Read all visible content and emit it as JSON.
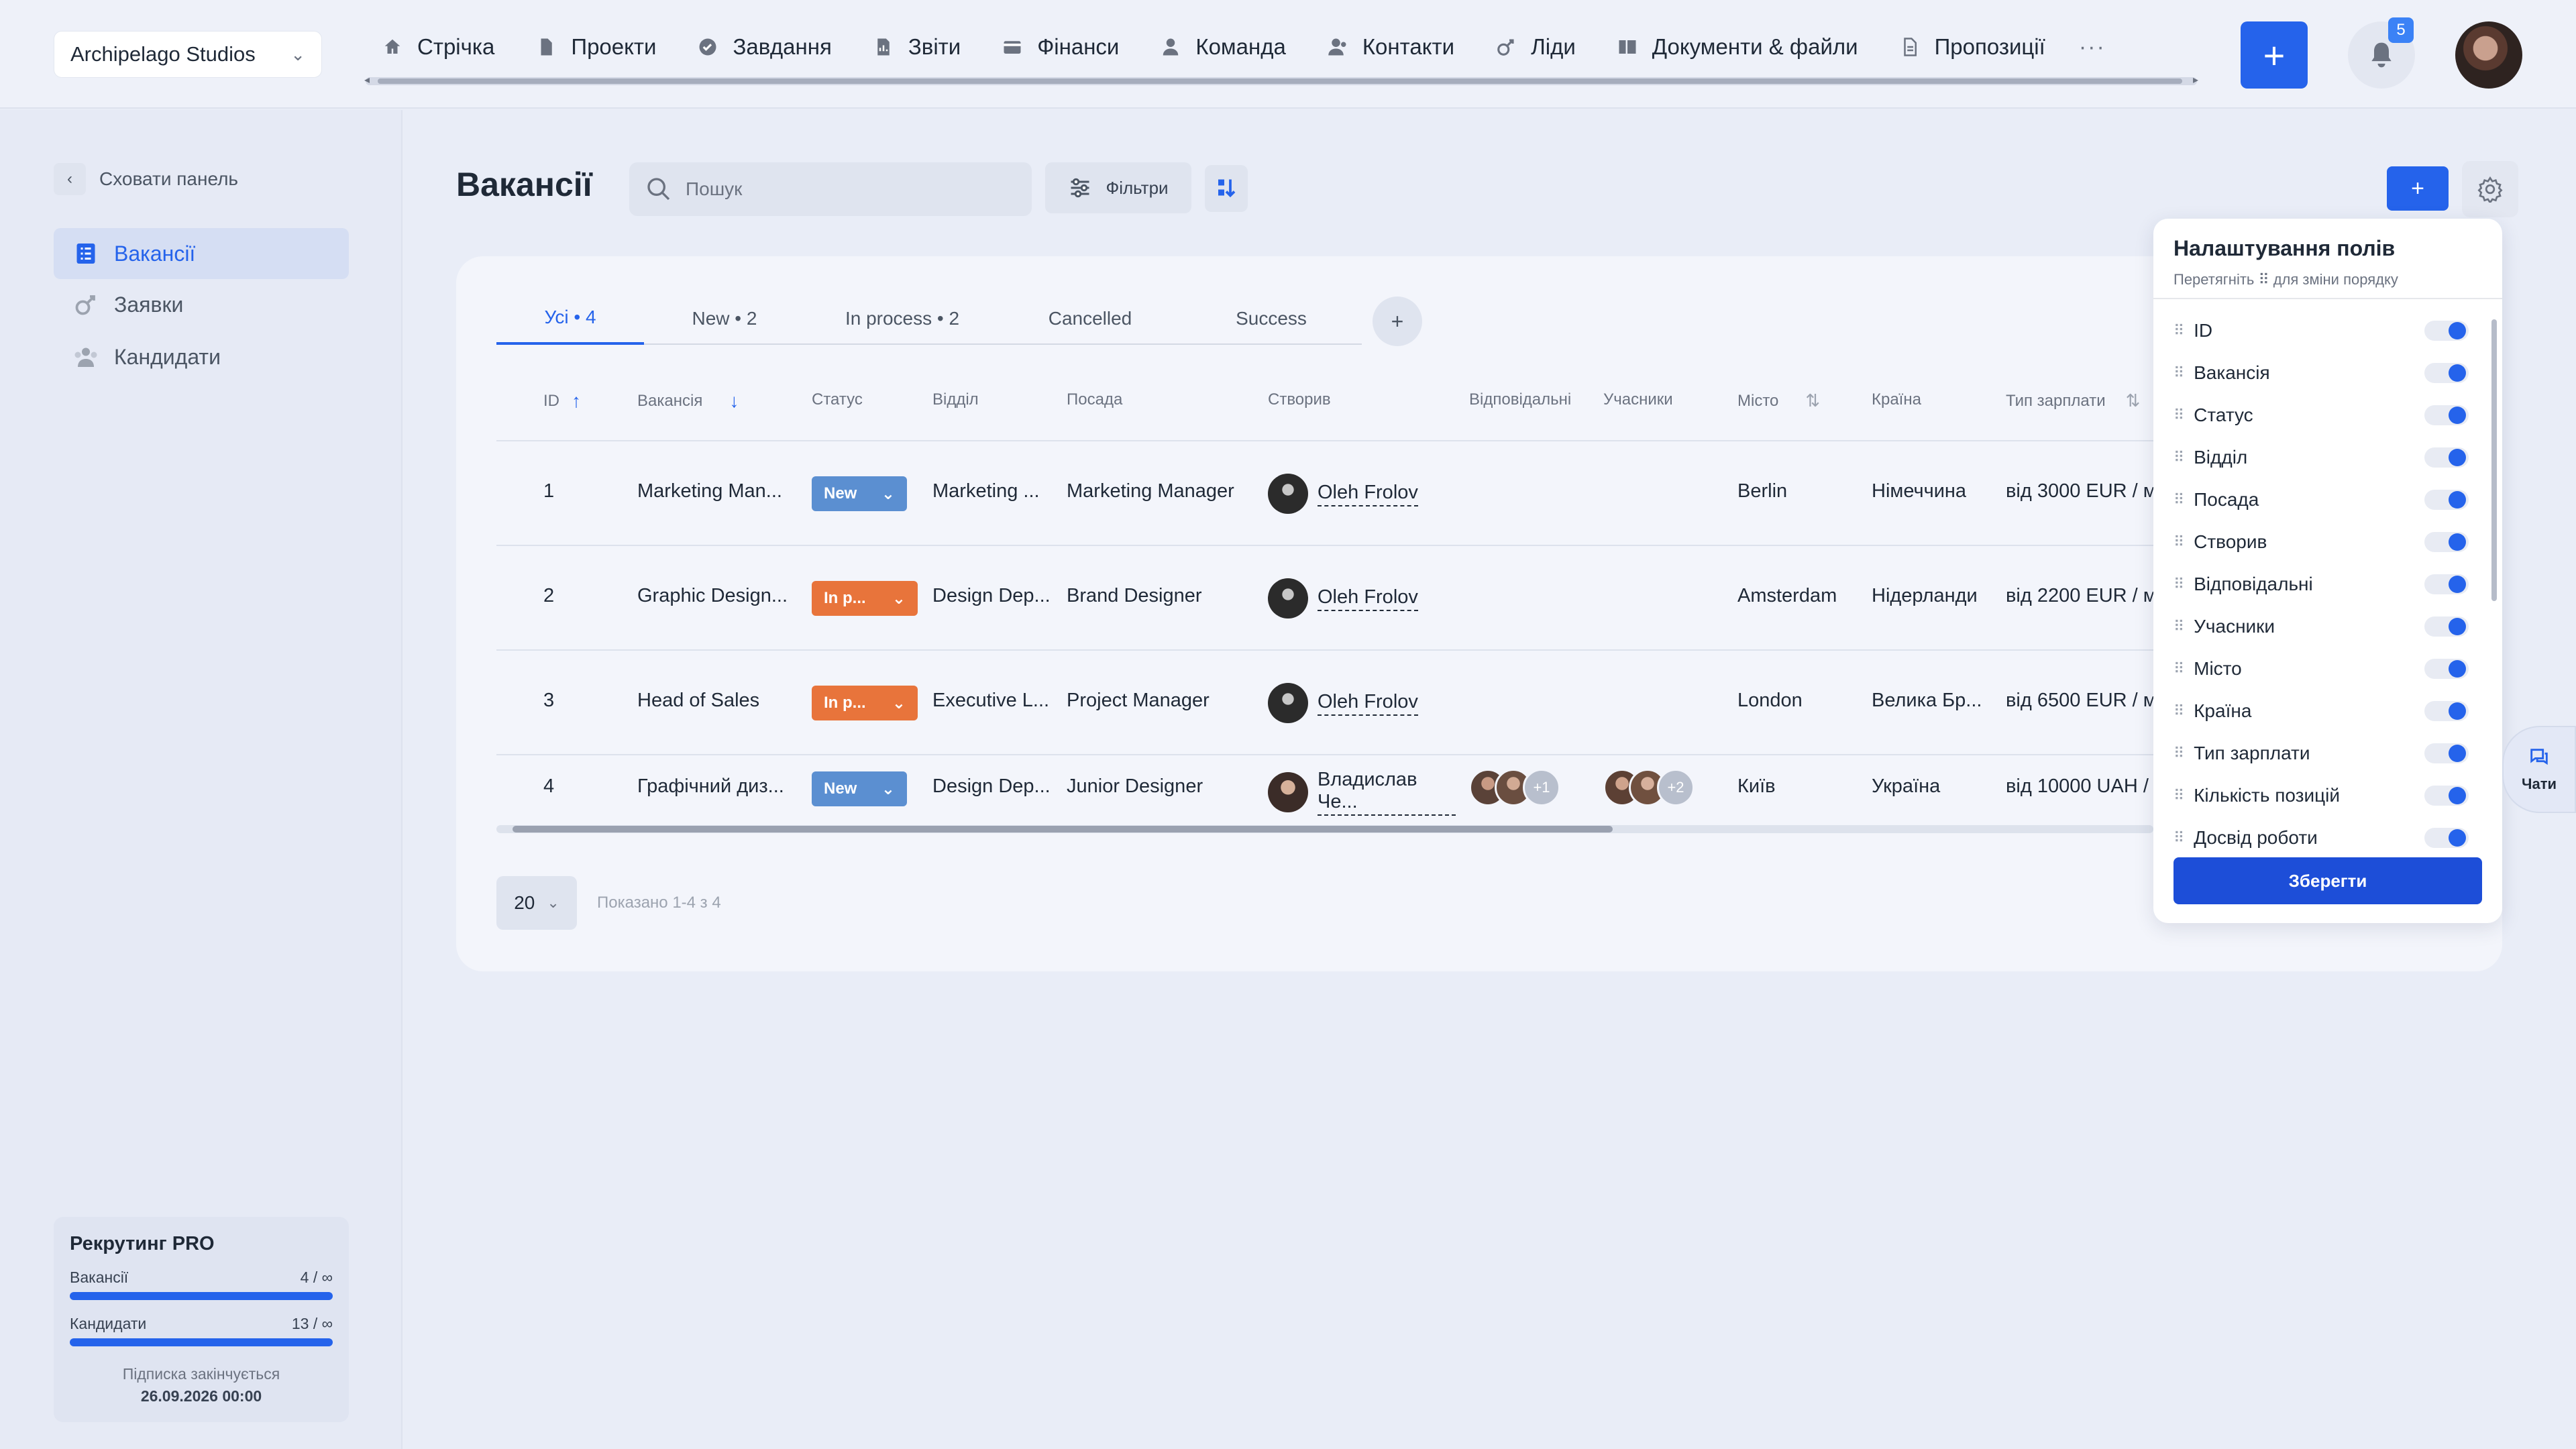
{
  "workspace": {
    "name": "Archipelago Studios"
  },
  "nav": {
    "items": [
      "Стрічка",
      "Проекти",
      "Завдання",
      "Звіти",
      "Фінанси",
      "Команда",
      "Контакти",
      "Ліди",
      "Документи & файли",
      "Пропозиції"
    ],
    "more": "···",
    "add": "+",
    "notifications": "5"
  },
  "sidebar": {
    "hide": "Сховати панель",
    "items": [
      "Вакансії",
      "Заявки",
      "Кандидати"
    ]
  },
  "plan": {
    "title": "Рекрутинг PRO",
    "rows": [
      {
        "label": "Вакансії",
        "value": "4 / ∞"
      },
      {
        "label": "Кандидати",
        "value": "13 / ∞"
      }
    ],
    "note": "Підписка закінчується",
    "date": "26.09.2026 00:00"
  },
  "page": {
    "title": "Вакансії",
    "search_placeholder": "Пошук",
    "filters": "Фільтри",
    "add": "+"
  },
  "tabs": [
    {
      "label": "Усі • 4",
      "active": true
    },
    {
      "label": "New • 2"
    },
    {
      "label": "In process • 2"
    },
    {
      "label": "Cancelled"
    },
    {
      "label": "Success"
    }
  ],
  "tab_add": "+",
  "table": {
    "headers": [
      "ID",
      "Вакансія",
      "Статус",
      "Відділ",
      "Посада",
      "Створив",
      "Відповідальні",
      "Учасники",
      "Місто",
      "Країна",
      "Тип зарплати"
    ],
    "rows": [
      {
        "id": "1",
        "vacancy": "Marketing Man...",
        "status": "New",
        "dept": "Marketing ...",
        "position": "Marketing Manager",
        "creator": "Oleh Frolov",
        "city": "Berlin",
        "country": "Німеччина",
        "salary": "від 3000 EUR / м"
      },
      {
        "id": "2",
        "vacancy": "Graphic Design...",
        "status": "In p...",
        "dept": "Design Dep...",
        "position": "Brand Designer",
        "creator": "Oleh Frolov",
        "city": "Amsterdam",
        "country": "Нідерланди",
        "salary": "від 2200 EUR / м"
      },
      {
        "id": "3",
        "vacancy": "Head of Sales",
        "status": "In p...",
        "dept": "Executive L...",
        "position": "Project Manager",
        "creator": "Oleh Frolov",
        "city": "London",
        "country": "Велика Бр...",
        "salary": "від 6500 EUR / м"
      },
      {
        "id": "4",
        "vacancy": "Графічний диз...",
        "status": "New",
        "dept": "Design Dep...",
        "position": "Junior Designer",
        "creator": "Владислав Че...",
        "resp_more": "+1",
        "part_more": "+2",
        "city": "Київ",
        "country": "Україна",
        "salary": "від 10000 UAH /"
      }
    ]
  },
  "pager": {
    "size": "20",
    "shown": "Показано 1-4 з 4"
  },
  "panel": {
    "title": "Налаштування полів",
    "subtitle": "Перетягніть ⠿ для зміни порядку",
    "fields": [
      "ID",
      "Вакансія",
      "Статус",
      "Відділ",
      "Посада",
      "Створив",
      "Відповідальні",
      "Учасники",
      "Місто",
      "Країна",
      "Тип зарплати",
      "Кількість позицій",
      "Досвід роботи"
    ],
    "save": "Зберегти"
  },
  "chats": {
    "label": "Чати"
  },
  "colors": {
    "accent": "#2563eb",
    "status_new": "#5b8fd1",
    "status_inprocess": "#e8743b"
  }
}
